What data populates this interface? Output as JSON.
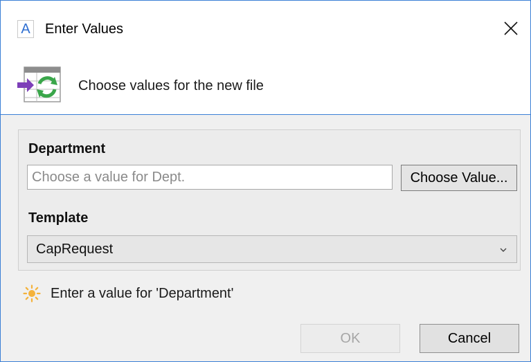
{
  "window": {
    "title": "Enter Values",
    "title_icon_letter": "A",
    "close_icon": "close-icon"
  },
  "header": {
    "text": "Choose values for the new file",
    "icon": "table-refresh-icon"
  },
  "form": {
    "department": {
      "label": "Department",
      "placeholder": "Choose a value for Dept.",
      "value": ""
    },
    "choose_button_label": "Choose Value...",
    "template": {
      "label": "Template",
      "selected": "CapRequest"
    }
  },
  "hint": {
    "icon": "sun-icon",
    "text": "Enter a value for 'Department'"
  },
  "buttons": {
    "ok": "OK",
    "cancel": "Cancel"
  },
  "colors": {
    "border_accent": "#3b7fd6",
    "icon_purple": "#7d3fb8",
    "icon_green": "#3aa64a",
    "hint_icon": "#f4b23b"
  }
}
